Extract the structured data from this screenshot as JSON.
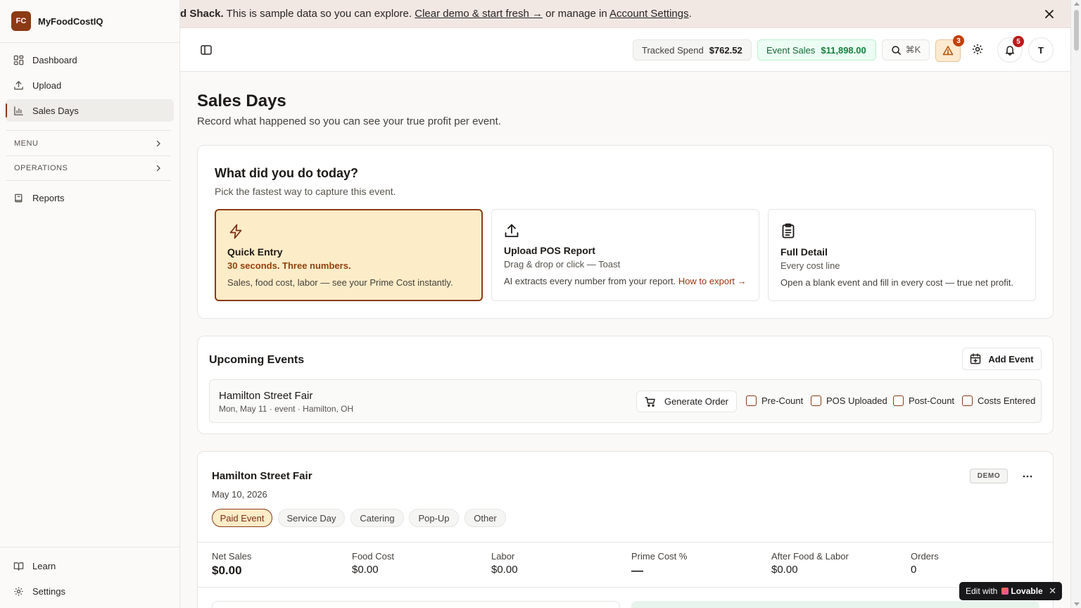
{
  "app": {
    "logo_initials": "FC",
    "name": "MyFoodCostIQ"
  },
  "sidebar": {
    "items": [
      {
        "label": "Dashboard",
        "icon": "dashboard-icon"
      },
      {
        "label": "Upload",
        "icon": "upload-icon"
      },
      {
        "label": "Sales Days",
        "icon": "bar-chart-icon",
        "active": true
      }
    ],
    "groups": [
      {
        "label": "MENU"
      },
      {
        "label": "OPERATIONS"
      }
    ],
    "reports": {
      "label": "Reports",
      "icon": "book-icon"
    },
    "bottom": [
      {
        "label": "Learn",
        "icon": "open-book-icon"
      },
      {
        "label": "Settings",
        "icon": "gear-icon"
      }
    ]
  },
  "banner": {
    "bold": "d Shack.",
    "text": " This is sample data so you can explore. ",
    "link_clear": "Clear demo & start fresh →",
    "text2": " or manage in ",
    "link_settings": "Account Settings",
    "text3": "."
  },
  "header": {
    "tracked_spend_label": "Tracked Spend",
    "tracked_spend_value": "$762.52",
    "event_sales_label": "Event Sales",
    "event_sales_value": "$11,898.00",
    "search_shortcut": "⌘K",
    "alerts_count": "3",
    "notifications_count": "5",
    "avatar_initial": "T"
  },
  "page": {
    "title": "Sales Days",
    "subtitle": "Record what happened so you can see your true profit per event."
  },
  "capture": {
    "title": "What did you do today?",
    "subtitle": "Pick the fastest way to capture this event.",
    "options": [
      {
        "title": "Quick Entry",
        "sub": "30 seconds. Three numbers.",
        "desc": "Sales, food cost, labor — see your Prime Cost instantly."
      },
      {
        "title": "Upload POS Report",
        "sub": "Drag & drop or click — Toast",
        "desc": "AI extracts every number from your report. ",
        "link": "How to export →"
      },
      {
        "title": "Full Detail",
        "sub": "Every cost line",
        "desc": "Open a blank event and fill in every cost — true net profit."
      }
    ]
  },
  "upcoming": {
    "title": "Upcoming Events",
    "add_label": "Add Event",
    "event": {
      "name": "Hamilton Street Fair",
      "meta": "Mon, May 11 · event · Hamilton, OH",
      "generate_label": "Generate Order",
      "checks": [
        "Pre-Count",
        "POS Uploaded",
        "Post-Count",
        "Costs Entered"
      ]
    }
  },
  "event_card": {
    "title": "Hamilton Street Fair",
    "date": "May 10, 2026",
    "badge": "DEMO",
    "more": "···",
    "types": [
      "Paid Event",
      "Service Day",
      "Catering",
      "Pop-Up",
      "Other"
    ],
    "stats": [
      {
        "label": "Net Sales",
        "value": "$0.00"
      },
      {
        "label": "Food Cost",
        "value": "$0.00"
      },
      {
        "label": "Labor",
        "value": "$0.00"
      },
      {
        "label": "Prime Cost %",
        "value": "—"
      },
      {
        "label": "After Food & Labor",
        "value": "$0.00"
      },
      {
        "label": "Orders",
        "value": "0"
      }
    ]
  },
  "lovable": {
    "edit_with": "Edit with",
    "brand": "Lovable",
    "close": "✕"
  },
  "colors": {
    "accent": "#8b3a14",
    "quick_entry_bg": "#fdecc8",
    "event_sales_green": "#15803d"
  }
}
